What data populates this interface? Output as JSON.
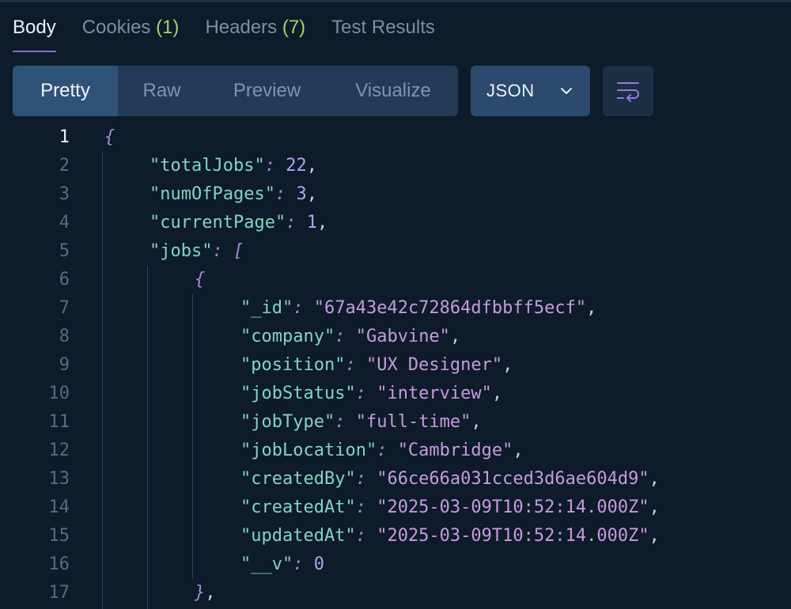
{
  "tabs": [
    {
      "label": "Body",
      "count": "",
      "active": true
    },
    {
      "label": "Cookies",
      "count": "(1)",
      "active": false
    },
    {
      "label": "Headers",
      "count": "(7)",
      "active": false
    },
    {
      "label": "Test Results",
      "count": "",
      "active": false
    }
  ],
  "view_modes": [
    "Pretty",
    "Raw",
    "Preview",
    "Visualize"
  ],
  "active_view_mode": "Pretty",
  "format": {
    "selected": "JSON"
  },
  "code_lines": [
    {
      "n": "1",
      "indent": 0,
      "tokens": [
        {
          "t": "brace",
          "v": "{"
        }
      ]
    },
    {
      "n": "2",
      "indent": 1,
      "tokens": [
        {
          "t": "key",
          "v": "\"totalJobs\""
        },
        {
          "t": "colon",
          "v": ": "
        },
        {
          "t": "num",
          "v": "22"
        },
        {
          "t": "punc",
          "v": ","
        }
      ]
    },
    {
      "n": "3",
      "indent": 1,
      "tokens": [
        {
          "t": "key",
          "v": "\"numOfPages\""
        },
        {
          "t": "colon",
          "v": ": "
        },
        {
          "t": "num",
          "v": "3"
        },
        {
          "t": "punc",
          "v": ","
        }
      ]
    },
    {
      "n": "4",
      "indent": 1,
      "tokens": [
        {
          "t": "key",
          "v": "\"currentPage\""
        },
        {
          "t": "colon",
          "v": ": "
        },
        {
          "t": "num",
          "v": "1"
        },
        {
          "t": "punc",
          "v": ","
        }
      ]
    },
    {
      "n": "5",
      "indent": 1,
      "tokens": [
        {
          "t": "key",
          "v": "\"jobs\""
        },
        {
          "t": "colon",
          "v": ": "
        },
        {
          "t": "brace",
          "v": "["
        }
      ]
    },
    {
      "n": "6",
      "indent": 2,
      "tokens": [
        {
          "t": "brace",
          "v": "{"
        }
      ]
    },
    {
      "n": "7",
      "indent": 3,
      "tokens": [
        {
          "t": "key",
          "v": "\"_id\""
        },
        {
          "t": "colon",
          "v": ": "
        },
        {
          "t": "str",
          "v": "\"67a43e42c72864dfbbff5ecf\""
        },
        {
          "t": "punc",
          "v": ","
        }
      ]
    },
    {
      "n": "8",
      "indent": 3,
      "tokens": [
        {
          "t": "key",
          "v": "\"company\""
        },
        {
          "t": "colon",
          "v": ": "
        },
        {
          "t": "str",
          "v": "\"Gabvine\""
        },
        {
          "t": "punc",
          "v": ","
        }
      ]
    },
    {
      "n": "9",
      "indent": 3,
      "tokens": [
        {
          "t": "key",
          "v": "\"position\""
        },
        {
          "t": "colon",
          "v": ": "
        },
        {
          "t": "str",
          "v": "\"UX Designer\""
        },
        {
          "t": "punc",
          "v": ","
        }
      ]
    },
    {
      "n": "10",
      "indent": 3,
      "tokens": [
        {
          "t": "key",
          "v": "\"jobStatus\""
        },
        {
          "t": "colon",
          "v": ": "
        },
        {
          "t": "str",
          "v": "\"interview\""
        },
        {
          "t": "punc",
          "v": ","
        }
      ]
    },
    {
      "n": "11",
      "indent": 3,
      "tokens": [
        {
          "t": "key",
          "v": "\"jobType\""
        },
        {
          "t": "colon",
          "v": ": "
        },
        {
          "t": "str",
          "v": "\"full-time\""
        },
        {
          "t": "punc",
          "v": ","
        }
      ]
    },
    {
      "n": "12",
      "indent": 3,
      "tokens": [
        {
          "t": "key",
          "v": "\"jobLocation\""
        },
        {
          "t": "colon",
          "v": ": "
        },
        {
          "t": "str",
          "v": "\"Cambridge\""
        },
        {
          "t": "punc",
          "v": ","
        }
      ]
    },
    {
      "n": "13",
      "indent": 3,
      "tokens": [
        {
          "t": "key",
          "v": "\"createdBy\""
        },
        {
          "t": "colon",
          "v": ": "
        },
        {
          "t": "str",
          "v": "\"66ce66a031cced3d6ae604d9\""
        },
        {
          "t": "punc",
          "v": ","
        }
      ]
    },
    {
      "n": "14",
      "indent": 3,
      "tokens": [
        {
          "t": "key",
          "v": "\"createdAt\""
        },
        {
          "t": "colon",
          "v": ": "
        },
        {
          "t": "str",
          "v": "\"2025-03-09T10:52:14.000Z\""
        },
        {
          "t": "punc",
          "v": ","
        }
      ]
    },
    {
      "n": "15",
      "indent": 3,
      "tokens": [
        {
          "t": "key",
          "v": "\"updatedAt\""
        },
        {
          "t": "colon",
          "v": ": "
        },
        {
          "t": "str",
          "v": "\"2025-03-09T10:52:14.000Z\""
        },
        {
          "t": "punc",
          "v": ","
        }
      ]
    },
    {
      "n": "16",
      "indent": 3,
      "tokens": [
        {
          "t": "key",
          "v": "\"__v\""
        },
        {
          "t": "colon",
          "v": ": "
        },
        {
          "t": "num",
          "v": "0"
        }
      ]
    },
    {
      "n": "17",
      "indent": 2,
      "tokens": [
        {
          "t": "brace",
          "v": "}"
        },
        {
          "t": "punc",
          "v": ","
        }
      ]
    }
  ],
  "current_line": "1",
  "colors": {
    "background": "#0d1b2a",
    "accent": "#8f6ad8",
    "count": "#a9d36a",
    "key": "#86d4c0",
    "string": "#c79be0"
  },
  "icons": {
    "format_dropdown": "chevron-down-icon",
    "wrap": "word-wrap-icon"
  }
}
